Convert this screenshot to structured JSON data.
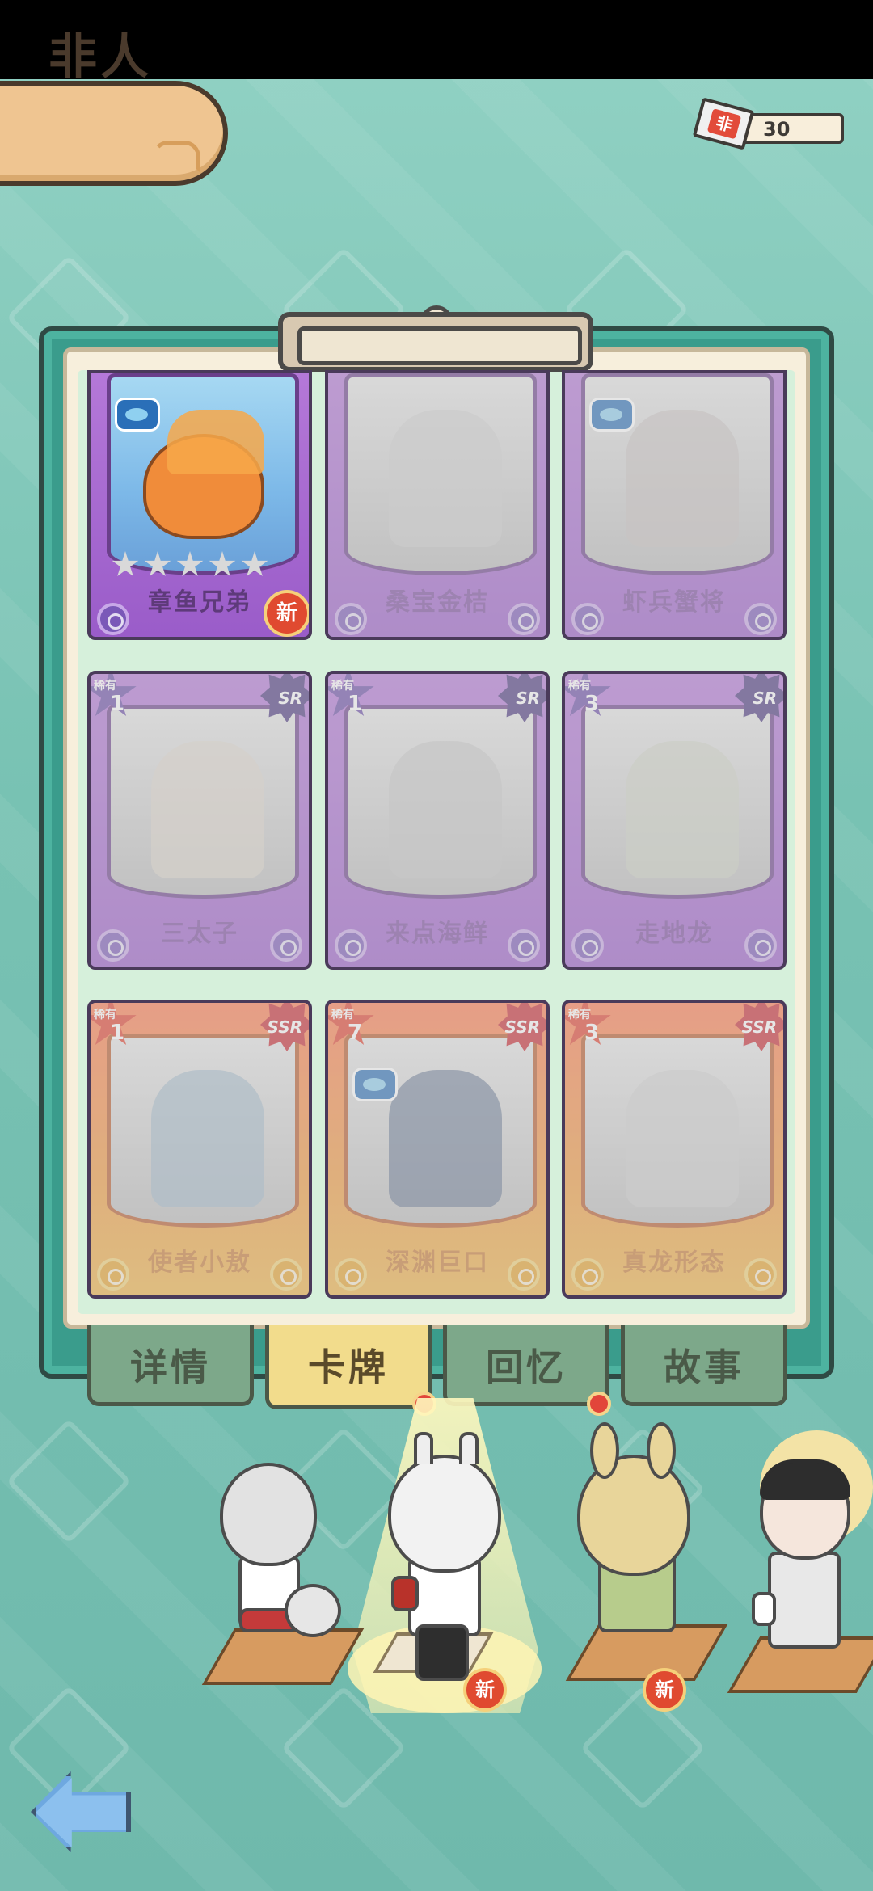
{
  "page": {
    "title": "非人"
  },
  "currency": {
    "icon_text": "非",
    "count": "30"
  },
  "cards": [
    {
      "name": "章鱼兄弟",
      "rarity": "",
      "level": "",
      "level_label": "",
      "is_new": true,
      "stars": 5,
      "locked": false
    },
    {
      "name": "桑宝金桔",
      "rarity": "",
      "level": "",
      "level_label": "",
      "is_new": false,
      "stars": 0,
      "locked": true
    },
    {
      "name": "虾兵蟹将",
      "rarity": "",
      "level": "",
      "level_label": "",
      "is_new": false,
      "stars": 0,
      "locked": true
    },
    {
      "name": "三太子",
      "rarity": "SR",
      "level": "1",
      "level_label": "稀有",
      "is_new": false,
      "stars": 0,
      "locked": true
    },
    {
      "name": "来点海鲜",
      "rarity": "SR",
      "level": "1",
      "level_label": "稀有",
      "is_new": false,
      "stars": 0,
      "locked": true
    },
    {
      "name": "走地龙",
      "rarity": "SR",
      "level": "3",
      "level_label": "稀有",
      "is_new": false,
      "stars": 0,
      "locked": true
    },
    {
      "name": "使者小敖",
      "rarity": "SSR",
      "level": "1",
      "level_label": "稀有",
      "is_new": false,
      "stars": 0,
      "locked": true
    },
    {
      "name": "深渊巨口",
      "rarity": "SSR",
      "level": "7",
      "level_label": "稀有",
      "is_new": false,
      "stars": 0,
      "locked": true
    },
    {
      "name": "真龙形态",
      "rarity": "SSR",
      "level": "3",
      "level_label": "稀有",
      "is_new": false,
      "stars": 0,
      "locked": true
    }
  ],
  "tabs": [
    {
      "label": "详情",
      "active": false,
      "dot": false
    },
    {
      "label": "卡牌",
      "active": true,
      "dot": true
    },
    {
      "label": "回忆",
      "active": false,
      "dot": false
    },
    {
      "label": "故事",
      "active": false,
      "dot": true
    }
  ],
  "characters": [
    {
      "id": "fox-boy",
      "new": false,
      "selected": false
    },
    {
      "id": "dragon-man",
      "new": true,
      "selected": true
    },
    {
      "id": "bunny-girl",
      "new": true,
      "selected": false
    },
    {
      "id": "dark-hair-man",
      "new": false,
      "selected": false
    }
  ],
  "badges": {
    "new_label": "新"
  },
  "colors": {
    "accent_red": "#e2453a",
    "sr_purple": "#9a5cc9",
    "ssr_orange": "#f29c40",
    "board_teal": "#3a9c8c"
  }
}
